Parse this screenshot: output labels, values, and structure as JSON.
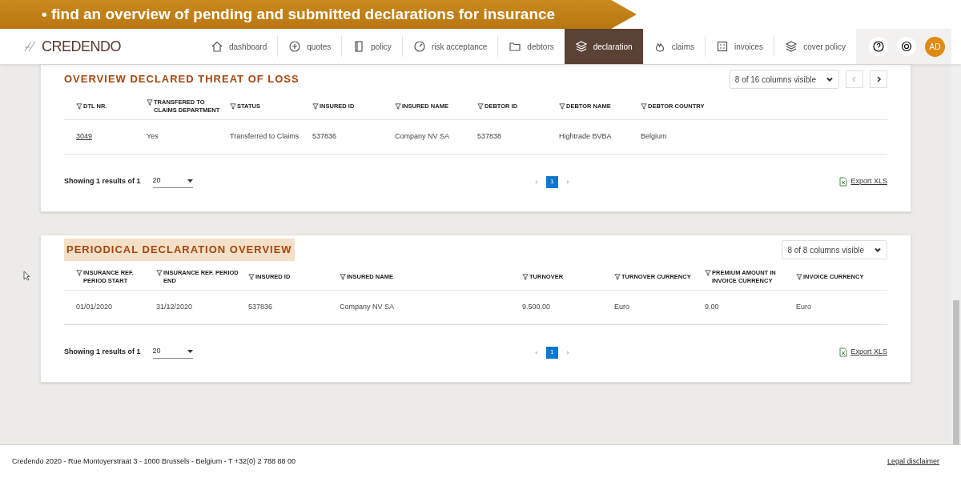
{
  "banner": {
    "text": "• find an overview of pending and submitted declarations for insurance"
  },
  "nav": {
    "logo": "CREDENDO",
    "items": [
      {
        "label": "dashboard",
        "selected": false
      },
      {
        "label": "quotes",
        "selected": false
      },
      {
        "label": "policy",
        "selected": false
      },
      {
        "label": "risk acceptance",
        "selected": false
      },
      {
        "label": "debtors",
        "selected": false
      },
      {
        "label": "declaration",
        "selected": true
      },
      {
        "label": "claims",
        "selected": false
      },
      {
        "label": "invoices",
        "selected": false
      },
      {
        "label": "cover policy",
        "selected": false
      }
    ],
    "avatar": "AD"
  },
  "sections": [
    {
      "title": "OVERVIEW DECLARED THREAT OF LOSS",
      "highlighted": false,
      "columns_visible": "8 of 16 columns visible",
      "scroll_arrows": true,
      "columns": [
        "DTL NR.",
        "TRANSFERED TO CLAIMS DEPARTMENT",
        "STATUS",
        "INSURED ID",
        "INSURED NAME",
        "DEBTOR ID",
        "DEBTOR NAME",
        "DEBTOR COUNTRY"
      ],
      "rows": [
        [
          {
            "text": "3049",
            "kind": "link"
          },
          {
            "text": "Yes",
            "kind": "text"
          },
          {
            "text": "Transferred to Claims",
            "kind": "text"
          },
          {
            "text": "537836",
            "kind": "text"
          },
          {
            "text": "Company NV SA",
            "kind": "text"
          },
          {
            "text": "537838",
            "kind": "text"
          },
          {
            "text": "Hightrade BVBA",
            "kind": "text"
          },
          {
            "text": "Belgium",
            "kind": "text"
          }
        ]
      ],
      "showing": "Showing 1 results of 1",
      "page_size": "20",
      "pages": [
        {
          "label": "1",
          "selected": true
        }
      ],
      "export": "Export XLS"
    },
    {
      "title": "PERIODICAL DECLARATION OVERVIEW",
      "highlighted": true,
      "columns_visible": "8 of 8 columns visible",
      "scroll_arrows": false,
      "columns": [
        "INSURANCE REF. PERIOD START",
        "INSURANCE REF. PERIOD END",
        "INSURED ID",
        "INSURED NAME",
        "TURNOVER",
        "TURNOVER CURRENCY",
        "PREMIUM AMOUNT IN INVOICE CURRENCY",
        "INVOICE CURRENCY"
      ],
      "rows": [
        [
          {
            "text": "01/01/2020",
            "kind": "text"
          },
          {
            "text": "31/12/2020",
            "kind": "text"
          },
          {
            "text": "537836",
            "kind": "text"
          },
          {
            "text": "Company NV SA",
            "kind": "text"
          },
          {
            "text": "9.500,00",
            "kind": "text"
          },
          {
            "text": "Euro",
            "kind": "text"
          },
          {
            "text": "9,00",
            "kind": "text"
          },
          {
            "text": "Euro",
            "kind": "text"
          }
        ]
      ],
      "showing": "Showing 1 results of 1",
      "page_size": "20",
      "pages": [
        {
          "label": "1",
          "selected": true
        }
      ],
      "export": "Export XLS"
    }
  ],
  "footer": {
    "address": "Credendo 2020 - Rue Montoyerstraat 3 - 1000 Brussels - Belgium - T +32(0) 2 788 88 00",
    "link": "Legal disclaimer"
  }
}
